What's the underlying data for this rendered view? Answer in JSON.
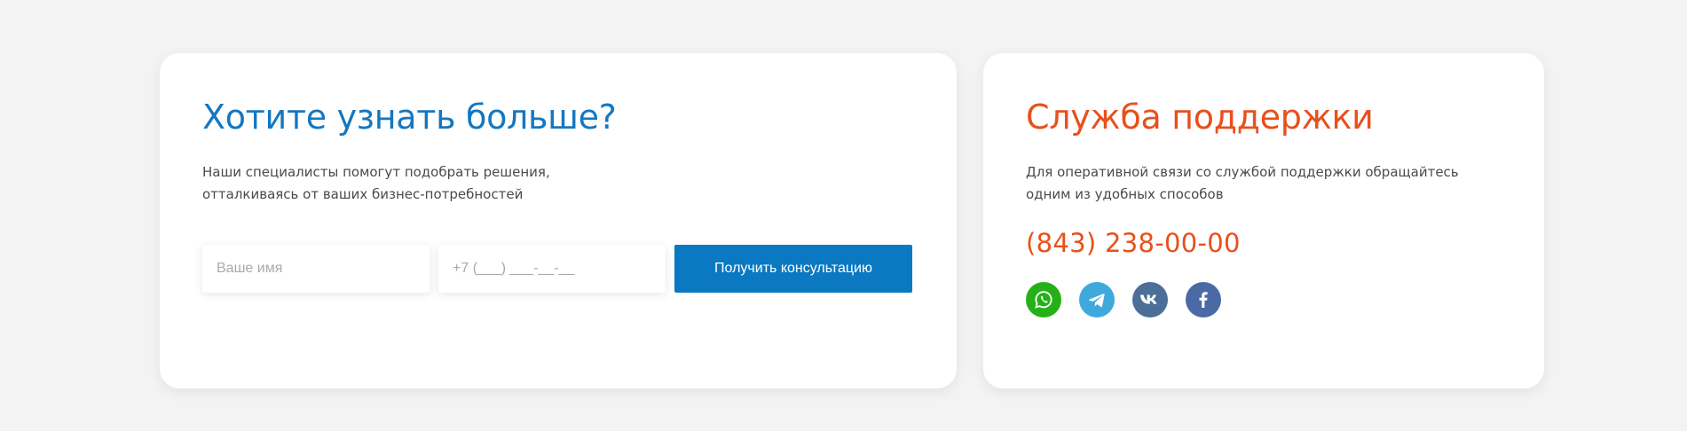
{
  "consult": {
    "title": "Хотите узнать больше?",
    "description": "Наши специалисты помогут подобрать решения, отталкиваясь от ваших бизнес-потребностей",
    "name_placeholder": "Ваше имя",
    "phone_placeholder": "+7 (___) ___-__-__",
    "submit_label": "Получить консультацию"
  },
  "support": {
    "title": "Служба поддержки",
    "description": "Для оперативной связи со службой поддержки обращайтесь одним из удобных способов",
    "phone": "(843) 238-00-00",
    "socials": [
      {
        "icon": "whatsapp-icon",
        "color": "#25b018"
      },
      {
        "icon": "telegram-icon",
        "color": "#3fa9dc"
      },
      {
        "icon": "vk-icon",
        "color": "#4c6f97"
      },
      {
        "icon": "facebook-icon",
        "color": "#4a6aa5"
      }
    ]
  },
  "colors": {
    "accent_blue": "#1577c0",
    "button_blue": "#0a79c2",
    "accent_orange": "#e8501c",
    "background": "#f3f3f3"
  }
}
